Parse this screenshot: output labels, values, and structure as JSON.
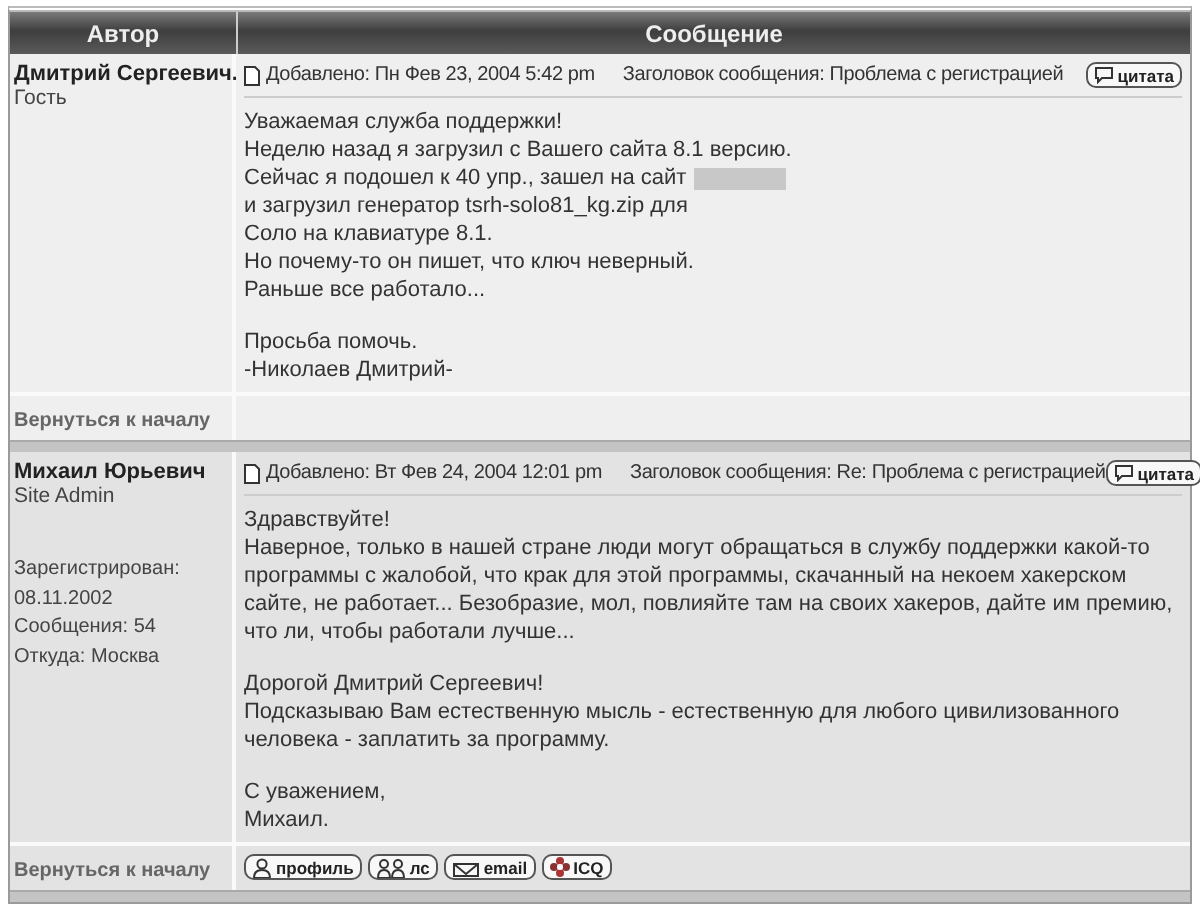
{
  "table": {
    "columns": [
      "Автор",
      "Сообщение"
    ],
    "posts": [
      {
        "author": "Дмитрий Сергеевич.",
        "rank": "Гость",
        "posted": "Добавлено: Пн Фев 23, 2004 5:42 pm",
        "subject": "Заголовок сообщения: Проблема с регистрацией",
        "quote_button": "цитата",
        "paragraphs": [
          [
            {
              "text": "Уважаемая служба поддержки!",
              "redacted": false
            },
            {
              "text": "Неделю назад я загрузил с Вашего сайта 8.1 версию.",
              "redacted": false
            },
            {
              "text": "Сейчас я подошел к 40 упр., зашел на сайт",
              "redacted": true
            },
            {
              "text": "и загрузил генератор tsrh-solo81_kg.zip для",
              "redacted": false
            },
            {
              "text": "Соло на клавиатуре 8.1.",
              "redacted": false
            },
            {
              "text": "Но почему-то он пишет, что ключ неверный.",
              "redacted": false
            },
            {
              "text": "Раньше все работало...",
              "redacted": false
            }
          ],
          [
            {
              "text": "Просьба помочь.",
              "redacted": false
            },
            {
              "text": "-Николаев Дмитрий-",
              "redacted": false
            }
          ]
        ],
        "back_link": "Вернуться к началу"
      },
      {
        "author": "Михаил Юрьевич",
        "rank": "Site Admin",
        "details": [
          "Зарегистрирован: 08.11.2002",
          "Сообщения: 54",
          "Откуда: Москва"
        ],
        "posted": "Добавлено: Вт Фев 24, 2004 12:01 pm",
        "subject": "Заголовок сообщения: Re: Проблема с регистрацией",
        "quote_button": "цитата",
        "paragraphs": [
          [
            {
              "text": "Здравствуйте!",
              "redacted": false
            },
            {
              "text": "Наверное, только в нашей стране люди могут обращаться в службу поддержки какой-то программы с жалобой, что крак для этой программы, скачанный на некоем хакерском сайте, не работает... Безобразие, мол, повлияйте там на своих хакеров, дайте им премию, что ли, чтобы работали лучше...",
              "redacted": false
            }
          ],
          [
            {
              "text": "Дорогой Дмитрий Сергеевич!",
              "redacted": false
            },
            {
              "text": "Подсказываю Вам естественную мысль - естественную для любого цивилизованного человека - заплатить за программу.",
              "redacted": false
            }
          ],
          [
            {
              "text": "С уважением,",
              "redacted": false
            },
            {
              "text": "Михаил.",
              "redacted": false
            }
          ]
        ],
        "back_link": "Вернуться к началу",
        "buttons": [
          {
            "kind": "profile",
            "label": "профиль"
          },
          {
            "kind": "pm",
            "label": "лс"
          },
          {
            "kind": "email",
            "label": "email"
          },
          {
            "kind": "icq",
            "label": "ICQ"
          }
        ]
      }
    ]
  }
}
